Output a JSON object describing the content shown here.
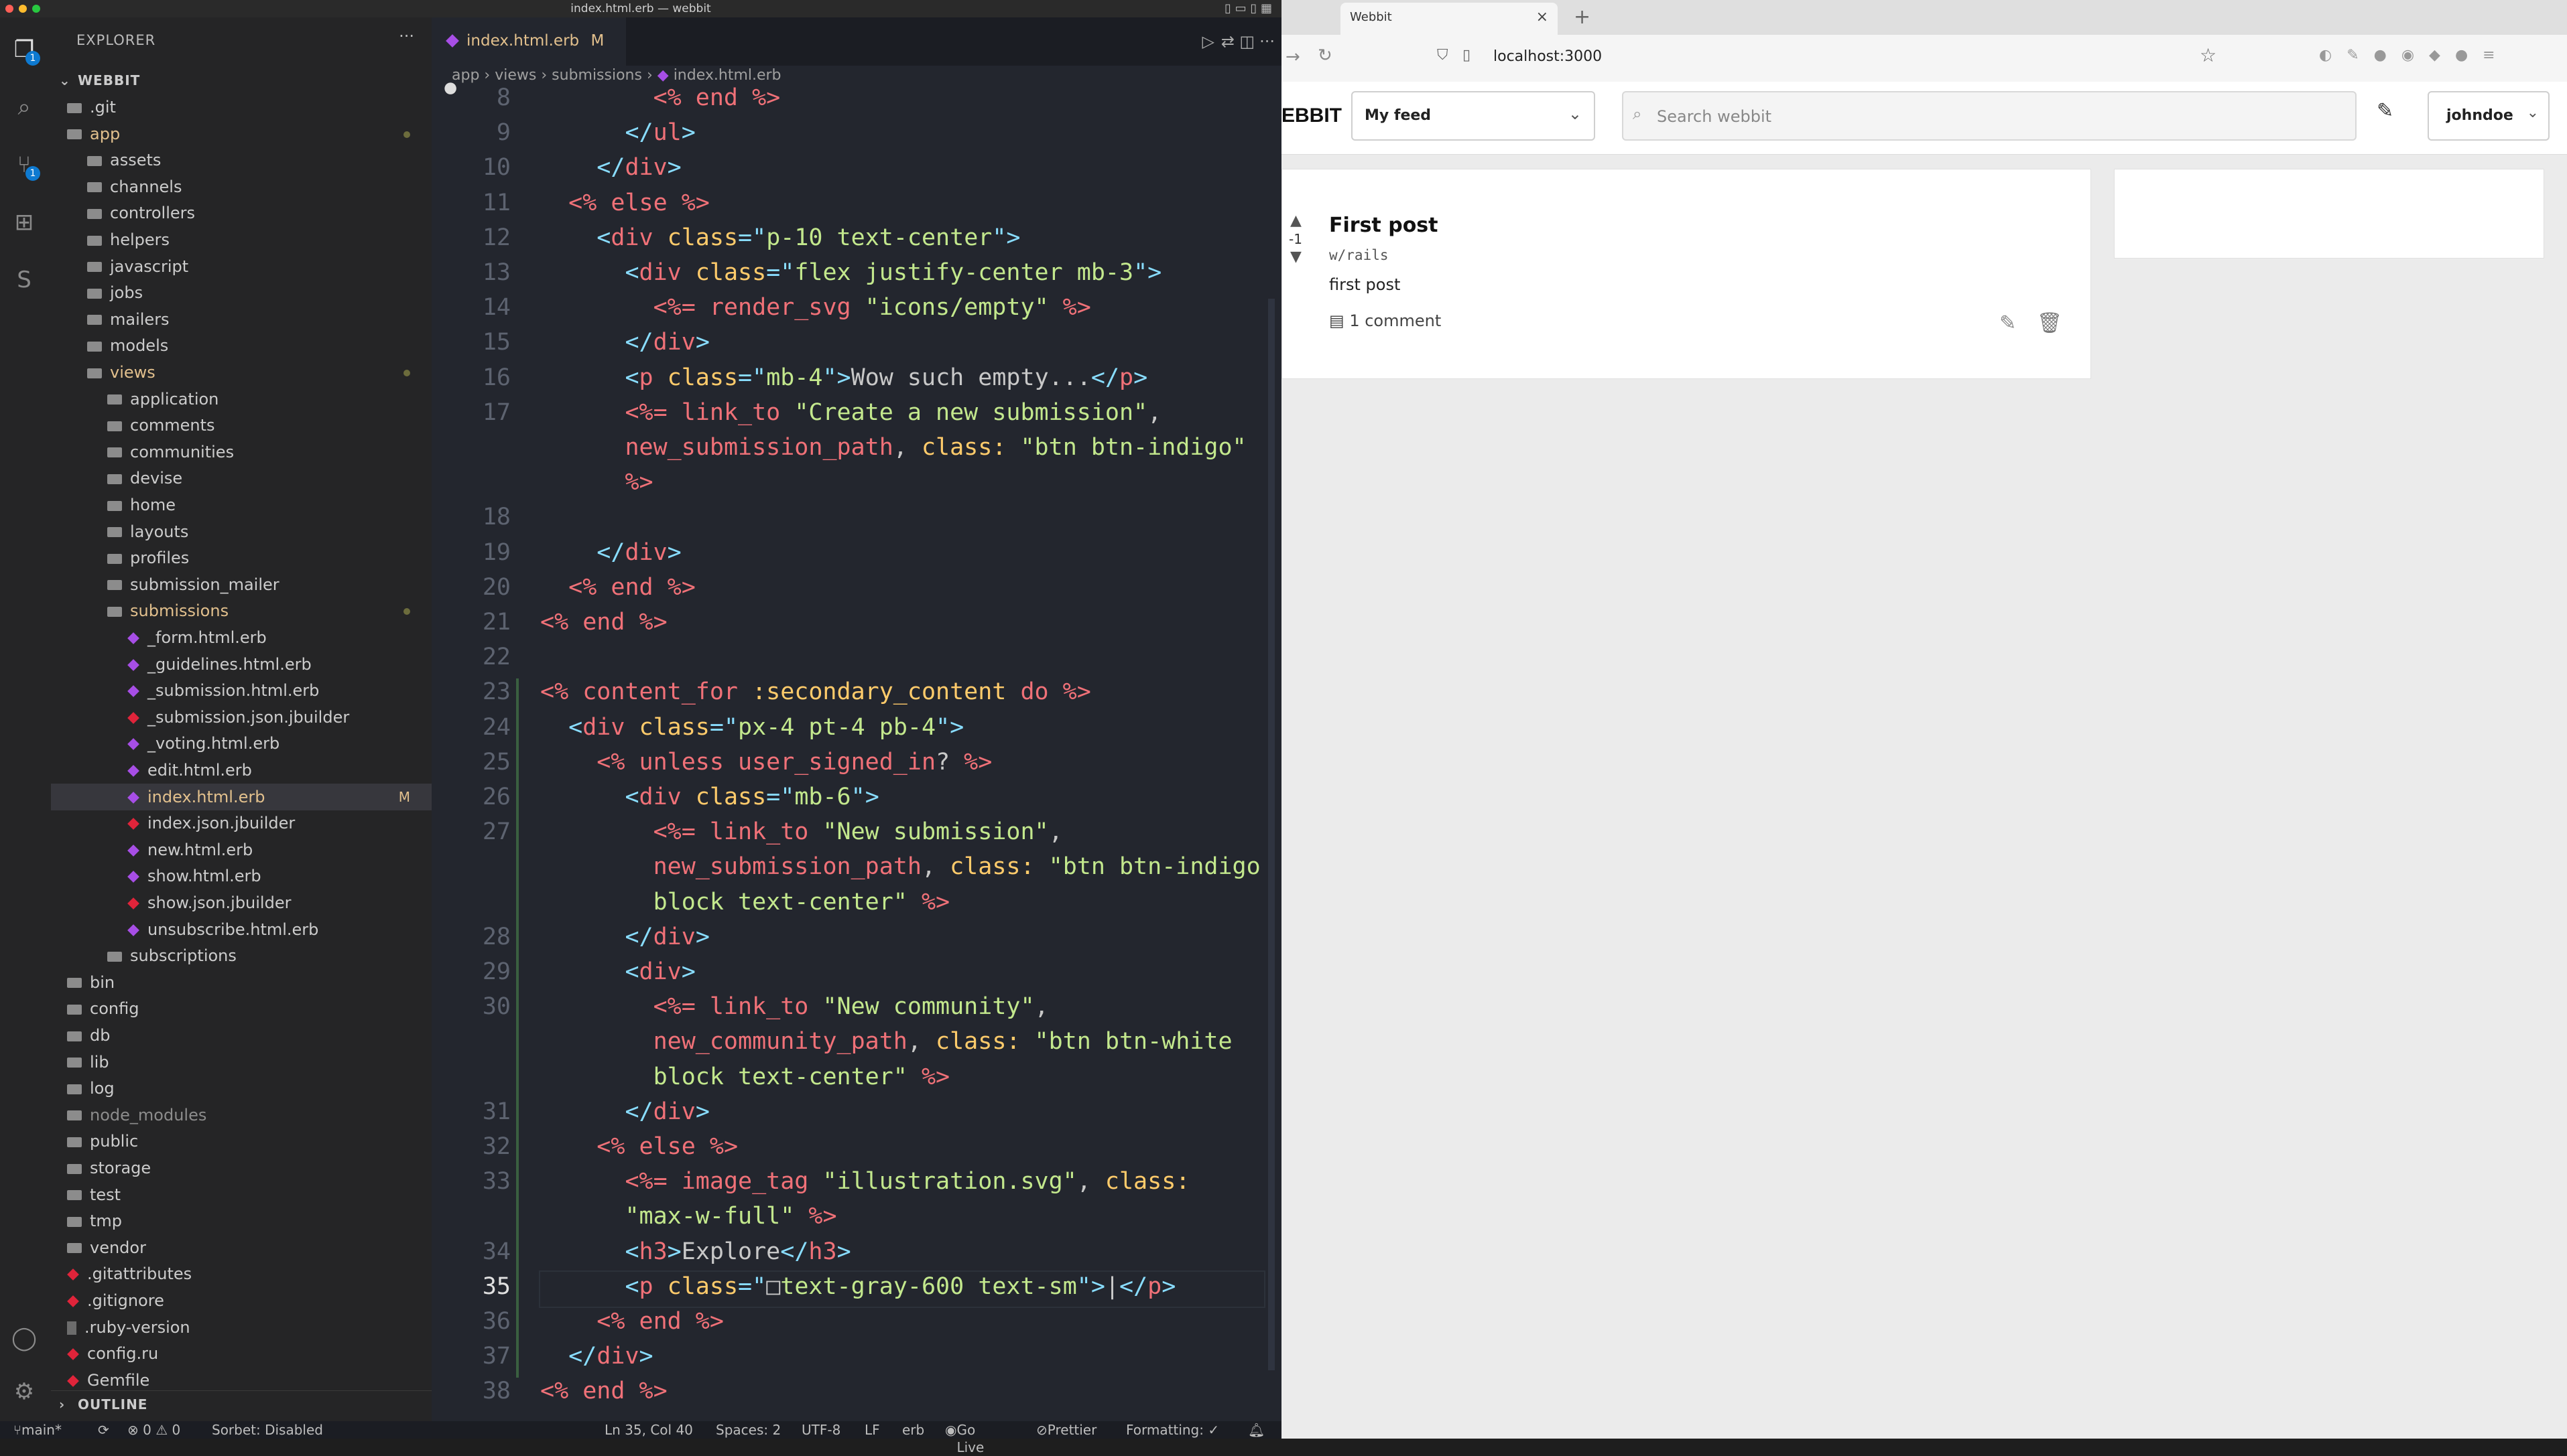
{
  "window": {
    "title": "index.html.erb — webbit"
  },
  "activity": {
    "explorer_badge": "1",
    "scm_badge": "1"
  },
  "sidebar": {
    "title": "EXPLORER",
    "more": "···",
    "root": "WEBBIT",
    "outline": "OUTLINE",
    "items": [
      {
        "label": ".git",
        "indent": 0,
        "kind": "folder"
      },
      {
        "label": "app",
        "indent": 0,
        "kind": "folder",
        "status": "mod"
      },
      {
        "label": "assets",
        "indent": 1,
        "kind": "folder"
      },
      {
        "label": "channels",
        "indent": 1,
        "kind": "folder"
      },
      {
        "label": "controllers",
        "indent": 1,
        "kind": "folder"
      },
      {
        "label": "helpers",
        "indent": 1,
        "kind": "folder"
      },
      {
        "label": "javascript",
        "indent": 1,
        "kind": "folder"
      },
      {
        "label": "jobs",
        "indent": 1,
        "kind": "folder"
      },
      {
        "label": "mailers",
        "indent": 1,
        "kind": "folder"
      },
      {
        "label": "models",
        "indent": 1,
        "kind": "folder"
      },
      {
        "label": "views",
        "indent": 1,
        "kind": "folder",
        "status": "mod"
      },
      {
        "label": "application",
        "indent": 2,
        "kind": "folder"
      },
      {
        "label": "comments",
        "indent": 2,
        "kind": "folder"
      },
      {
        "label": "communities",
        "indent": 2,
        "kind": "folder"
      },
      {
        "label": "devise",
        "indent": 2,
        "kind": "folder"
      },
      {
        "label": "home",
        "indent": 2,
        "kind": "folder"
      },
      {
        "label": "layouts",
        "indent": 2,
        "kind": "folder"
      },
      {
        "label": "profiles",
        "indent": 2,
        "kind": "folder"
      },
      {
        "label": "submission_mailer",
        "indent": 2,
        "kind": "folder"
      },
      {
        "label": "submissions",
        "indent": 2,
        "kind": "folder",
        "status": "mod"
      },
      {
        "label": "_form.html.erb",
        "indent": 3,
        "kind": "erb"
      },
      {
        "label": "_guidelines.html.erb",
        "indent": 3,
        "kind": "erb"
      },
      {
        "label": "_submission.html.erb",
        "indent": 3,
        "kind": "erb"
      },
      {
        "label": "_submission.json.jbuilder",
        "indent": 3,
        "kind": "rb"
      },
      {
        "label": "_voting.html.erb",
        "indent": 3,
        "kind": "erb"
      },
      {
        "label": "edit.html.erb",
        "indent": 3,
        "kind": "erb"
      },
      {
        "label": "index.html.erb",
        "indent": 3,
        "kind": "erb",
        "status": "M",
        "selected": true
      },
      {
        "label": "index.json.jbuilder",
        "indent": 3,
        "kind": "rb"
      },
      {
        "label": "new.html.erb",
        "indent": 3,
        "kind": "erb"
      },
      {
        "label": "show.html.erb",
        "indent": 3,
        "kind": "erb"
      },
      {
        "label": "show.json.jbuilder",
        "indent": 3,
        "kind": "rb"
      },
      {
        "label": "unsubscribe.html.erb",
        "indent": 3,
        "kind": "erb"
      },
      {
        "label": "subscriptions",
        "indent": 2,
        "kind": "folder"
      },
      {
        "label": "bin",
        "indent": 0,
        "kind": "folder"
      },
      {
        "label": "config",
        "indent": 0,
        "kind": "folder"
      },
      {
        "label": "db",
        "indent": 0,
        "kind": "folder"
      },
      {
        "label": "lib",
        "indent": 0,
        "kind": "folder"
      },
      {
        "label": "log",
        "indent": 0,
        "kind": "folder"
      },
      {
        "label": "node_modules",
        "indent": 0,
        "kind": "folder",
        "dim": true
      },
      {
        "label": "public",
        "indent": 0,
        "kind": "folder"
      },
      {
        "label": "storage",
        "indent": 0,
        "kind": "folder"
      },
      {
        "label": "test",
        "indent": 0,
        "kind": "folder"
      },
      {
        "label": "tmp",
        "indent": 0,
        "kind": "folder"
      },
      {
        "label": "vendor",
        "indent": 0,
        "kind": "folder"
      },
      {
        "label": ".gitattributes",
        "indent": 0,
        "kind": "rb"
      },
      {
        "label": ".gitignore",
        "indent": 0,
        "kind": "rb"
      },
      {
        "label": ".ruby-version",
        "indent": 0,
        "kind": "file"
      },
      {
        "label": "config.ru",
        "indent": 0,
        "kind": "rb"
      },
      {
        "label": "Gemfile",
        "indent": 0,
        "kind": "rb"
      }
    ]
  },
  "editor": {
    "tab_label": "index.html.erb",
    "tab_status": "M",
    "tab_dirty": "●",
    "breadcrumbs": [
      "app",
      "views",
      "submissions",
      "index.html.erb"
    ],
    "lines": [
      {
        "n": "8",
        "i": 4,
        "parts": [
          [
            "t",
            "<% end %>"
          ]
        ]
      },
      {
        "n": "9",
        "i": 3,
        "parts": [
          [
            "p",
            "</"
          ],
          [
            "t",
            "ul"
          ],
          [
            "p",
            ">"
          ]
        ]
      },
      {
        "n": "10",
        "i": 2,
        "parts": [
          [
            "p",
            "</"
          ],
          [
            "t",
            "div"
          ],
          [
            "p",
            ">"
          ]
        ]
      },
      {
        "n": "11",
        "i": 1,
        "parts": [
          [
            "t",
            "<% else %>"
          ]
        ]
      },
      {
        "n": "12",
        "i": 2,
        "parts": [
          [
            "p",
            "<"
          ],
          [
            "t",
            "div"
          ],
          [
            "a",
            " class"
          ],
          [
            "p",
            "=\""
          ],
          [
            "s",
            "p-10 text-center"
          ],
          [
            "p",
            "\">"
          ]
        ]
      },
      {
        "n": "13",
        "i": 3,
        "parts": [
          [
            "p",
            "<"
          ],
          [
            "t",
            "div"
          ],
          [
            "a",
            " class"
          ],
          [
            "p",
            "=\""
          ],
          [
            "s",
            "flex justify-center mb-3"
          ],
          [
            "p",
            "\">"
          ]
        ]
      },
      {
        "n": "14",
        "i": 4,
        "parts": [
          [
            "t",
            "<%= render_svg "
          ],
          [
            "s",
            "\"icons/empty\""
          ],
          [
            "t",
            " %>"
          ]
        ]
      },
      {
        "n": "15",
        "i": 3,
        "parts": [
          [
            "p",
            "</"
          ],
          [
            "t",
            "div"
          ],
          [
            "p",
            ">"
          ]
        ]
      },
      {
        "n": "16",
        "i": 3,
        "parts": [
          [
            "p",
            "<"
          ],
          [
            "t",
            "p"
          ],
          [
            "a",
            " class"
          ],
          [
            "p",
            "=\""
          ],
          [
            "s",
            "mb-4"
          ],
          [
            "p",
            "\">"
          ],
          [
            "w",
            "Wow such empty..."
          ],
          [
            "p",
            "</"
          ],
          [
            "t",
            "p"
          ],
          [
            "p",
            ">"
          ]
        ]
      },
      {
        "n": "17",
        "i": 3,
        "parts": [
          [
            "t",
            "<%= link_to "
          ],
          [
            "s",
            "\"Create a new submission\""
          ],
          [
            "w",
            ","
          ]
        ]
      },
      {
        "n": "",
        "i": 3,
        "parts": [
          [
            "t",
            "new_submission_path"
          ],
          [
            "w",
            ", "
          ],
          [
            "a",
            "class:"
          ],
          [
            "s",
            " \"btn btn-indigo\""
          ]
        ]
      },
      {
        "n": "",
        "i": 3,
        "parts": [
          [
            "t",
            "%>"
          ]
        ]
      },
      {
        "n": "18",
        "i": 0,
        "parts": []
      },
      {
        "n": "19",
        "i": 2,
        "parts": [
          [
            "p",
            "</"
          ],
          [
            "t",
            "div"
          ],
          [
            "p",
            ">"
          ]
        ]
      },
      {
        "n": "20",
        "i": 1,
        "parts": [
          [
            "t",
            "<% end %>"
          ]
        ]
      },
      {
        "n": "21",
        "i": 0,
        "parts": [
          [
            "t",
            "<% end %>"
          ]
        ]
      },
      {
        "n": "22",
        "i": 0,
        "parts": []
      },
      {
        "n": "23",
        "i": 0,
        "parts": [
          [
            "t",
            "<% content_for "
          ],
          [
            "a",
            ":secondary_content"
          ],
          [
            "t",
            " do %>"
          ]
        ]
      },
      {
        "n": "24",
        "i": 1,
        "parts": [
          [
            "p",
            "<"
          ],
          [
            "t",
            "div"
          ],
          [
            "a",
            " class"
          ],
          [
            "p",
            "=\""
          ],
          [
            "s",
            "px-4 pt-4 pb-4"
          ],
          [
            "p",
            "\">"
          ]
        ]
      },
      {
        "n": "25",
        "i": 2,
        "parts": [
          [
            "t",
            "<% unless "
          ],
          [
            "t",
            "user_signed_in"
          ],
          [
            "w",
            "?"
          ],
          [
            "t",
            " %>"
          ]
        ]
      },
      {
        "n": "26",
        "i": 3,
        "parts": [
          [
            "p",
            "<"
          ],
          [
            "t",
            "div"
          ],
          [
            "a",
            " class"
          ],
          [
            "p",
            "=\""
          ],
          [
            "s",
            "mb-6"
          ],
          [
            "p",
            "\">"
          ]
        ]
      },
      {
        "n": "27",
        "i": 4,
        "parts": [
          [
            "t",
            "<%= link_to "
          ],
          [
            "s",
            "\"New submission\""
          ],
          [
            "w",
            ","
          ]
        ]
      },
      {
        "n": "",
        "i": 4,
        "parts": [
          [
            "t",
            "new_submission_path"
          ],
          [
            "w",
            ", "
          ],
          [
            "a",
            "class:"
          ],
          [
            "s",
            " \"btn btn-indigo"
          ]
        ]
      },
      {
        "n": "",
        "i": 4,
        "parts": [
          [
            "s",
            "block text-center\""
          ],
          [
            "t",
            " %>"
          ]
        ]
      },
      {
        "n": "28",
        "i": 3,
        "parts": [
          [
            "p",
            "</"
          ],
          [
            "t",
            "div"
          ],
          [
            "p",
            ">"
          ]
        ]
      },
      {
        "n": "29",
        "i": 3,
        "parts": [
          [
            "p",
            "<"
          ],
          [
            "t",
            "div"
          ],
          [
            "p",
            ">"
          ]
        ]
      },
      {
        "n": "30",
        "i": 4,
        "parts": [
          [
            "t",
            "<%= link_to "
          ],
          [
            "s",
            "\"New community\""
          ],
          [
            "w",
            ","
          ]
        ]
      },
      {
        "n": "",
        "i": 4,
        "parts": [
          [
            "t",
            "new_community_path"
          ],
          [
            "w",
            ", "
          ],
          [
            "a",
            "class:"
          ],
          [
            "s",
            " \"btn btn-white"
          ]
        ]
      },
      {
        "n": "",
        "i": 4,
        "parts": [
          [
            "s",
            "block text-center\""
          ],
          [
            "t",
            " %>"
          ]
        ]
      },
      {
        "n": "31",
        "i": 3,
        "parts": [
          [
            "p",
            "</"
          ],
          [
            "t",
            "div"
          ],
          [
            "p",
            ">"
          ]
        ]
      },
      {
        "n": "32",
        "i": 2,
        "parts": [
          [
            "t",
            "<% else %>"
          ]
        ]
      },
      {
        "n": "33",
        "i": 3,
        "parts": [
          [
            "t",
            "<%= image_tag "
          ],
          [
            "s",
            "\"illustration.svg\""
          ],
          [
            "w",
            ", "
          ],
          [
            "a",
            "class:"
          ]
        ]
      },
      {
        "n": "",
        "i": 3,
        "parts": [
          [
            "s",
            "\"max-w-full\""
          ],
          [
            "t",
            " %>"
          ]
        ]
      },
      {
        "n": "34",
        "i": 3,
        "parts": [
          [
            "p",
            "<"
          ],
          [
            "t",
            "h3"
          ],
          [
            "p",
            ">"
          ],
          [
            "w",
            "Explore"
          ],
          [
            "p",
            "</"
          ],
          [
            "t",
            "h3"
          ],
          [
            "p",
            ">"
          ]
        ]
      },
      {
        "n": "35",
        "i": 3,
        "parts": [
          [
            "p",
            "<"
          ],
          [
            "t",
            "p"
          ],
          [
            "a",
            " class"
          ],
          [
            "p",
            "=\""
          ],
          [
            "w",
            "□"
          ],
          [
            "s",
            "text-gray-600 text-sm"
          ],
          [
            "p",
            "\">"
          ],
          [
            "w",
            "|"
          ],
          [
            "p",
            "</"
          ],
          [
            "t",
            "p"
          ],
          [
            "p",
            ">"
          ]
        ],
        "current": true
      },
      {
        "n": "36",
        "i": 2,
        "parts": [
          [
            "t",
            "<% end %>"
          ]
        ]
      },
      {
        "n": "37",
        "i": 1,
        "parts": [
          [
            "p",
            "</"
          ],
          [
            "t",
            "div"
          ],
          [
            "p",
            ">"
          ]
        ]
      },
      {
        "n": "38",
        "i": 0,
        "parts": [
          [
            "t",
            "<% end %>"
          ]
        ]
      }
    ]
  },
  "statusbar": {
    "branch": "main*",
    "problems": "⊗ 0 ⚠ 0",
    "sorbet": "Sorbet: Disabled",
    "position": "Ln 35, Col 40",
    "spaces": "Spaces: 2",
    "encoding": "UTF-8",
    "eol": "LF",
    "language": "erb",
    "golive": "Go Live",
    "prettier": "Prettier",
    "formatting": "Formatting: ✓"
  },
  "browser": {
    "tab_title": "Webbit",
    "url": "localhost:3000",
    "brand": "EBBIT",
    "feed_select": "My feed",
    "search_placeholder": "Search webbit",
    "user_menu": "johndoe",
    "post": {
      "title": "First post",
      "community": "w/rails",
      "body": "first post",
      "votes": "-1",
      "comments": "1 comment"
    }
  }
}
